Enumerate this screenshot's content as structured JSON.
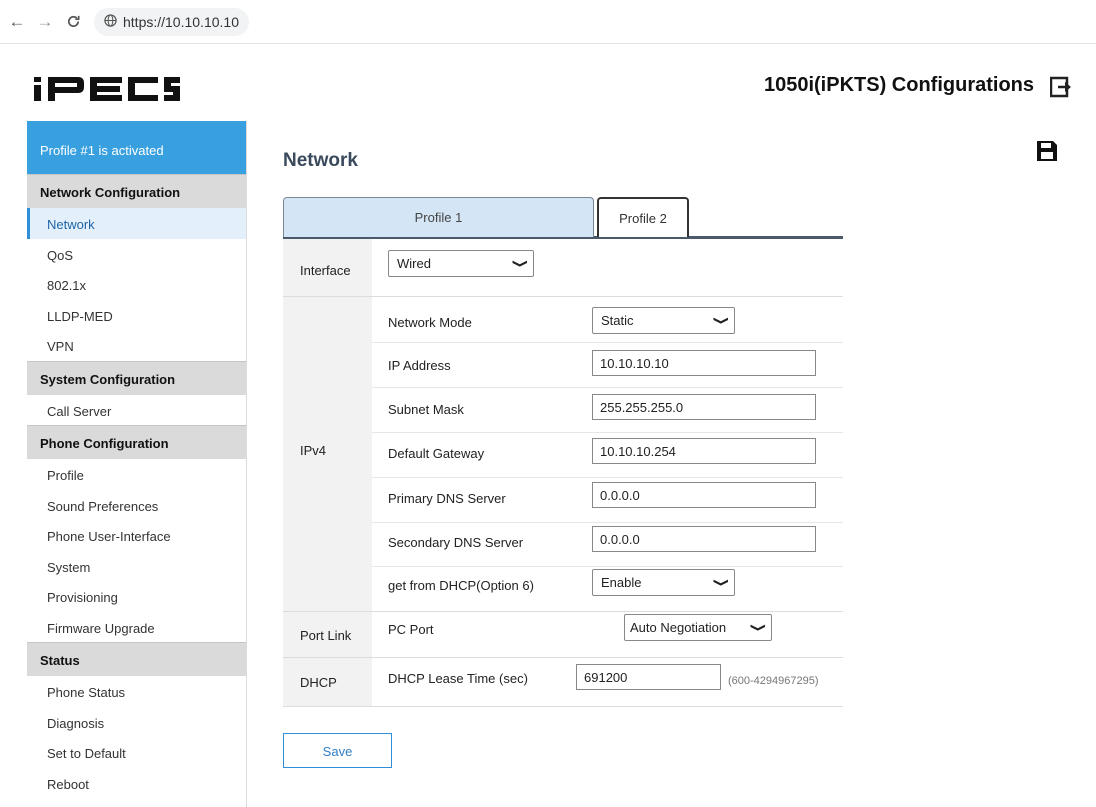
{
  "browser": {
    "back_icon": "←",
    "forward_icon": "→",
    "reload_icon": "C",
    "url": "https://10.10.10.10"
  },
  "header": {
    "logo_text": "iPECS",
    "title": "1050i(iPKTS) Configurations",
    "logout_icon": "logout-icon"
  },
  "sidebar": {
    "banner": "Profile #1 is activated",
    "sections": [
      {
        "title": "Network Configuration",
        "items": [
          "Network",
          "QoS",
          "802.1x",
          "LLDP-MED",
          "VPN"
        ]
      },
      {
        "title": "System Configuration",
        "items": [
          "Call Server"
        ]
      },
      {
        "title": "Phone Configuration",
        "items": [
          "Profile",
          "Sound Preferences",
          "Phone User-Interface",
          "System",
          "Provisioning",
          "Firmware Upgrade"
        ]
      },
      {
        "title": "Status",
        "items": [
          "Phone Status",
          "Diagnosis",
          "Set to Default",
          "Reboot"
        ]
      }
    ],
    "active_item": "Network"
  },
  "main": {
    "page_title": "Network",
    "save_icon": "floppy-disk-icon",
    "tabs": [
      "Profile 1",
      "Profile 2"
    ],
    "interface": {
      "label": "Interface",
      "value": "Wired"
    },
    "ipv4": {
      "label": "IPv4",
      "network_mode": {
        "label": "Network Mode",
        "value": "Static"
      },
      "ip_address": {
        "label": "IP Address",
        "value": "10.10.10.10"
      },
      "subnet_mask": {
        "label": "Subnet Mask",
        "value": "255.255.255.0"
      },
      "default_gateway": {
        "label": "Default Gateway",
        "value": "10.10.10.254"
      },
      "primary_dns": {
        "label": "Primary DNS Server",
        "value": "0.0.0.0"
      },
      "secondary_dns": {
        "label": "Secondary DNS Server",
        "value": "0.0.0.0"
      },
      "dhcp_option6": {
        "label": "get from DHCP(Option 6)",
        "value": "Enable"
      }
    },
    "port_link": {
      "label": "Port Link",
      "pc_port_label": "PC Port",
      "pc_port_value": "Auto Negotiation"
    },
    "dhcp": {
      "label": "DHCP",
      "lease_label": "DHCP Lease Time (sec)",
      "lease_value": "691200",
      "lease_range": "(600-4294967295)"
    },
    "save_label": "Save"
  },
  "colors": {
    "accent": "#39a0e0",
    "active_bg": "#e3f0fb",
    "section_bg": "#dadada",
    "tab_active_bg": "#d4e6f5"
  }
}
